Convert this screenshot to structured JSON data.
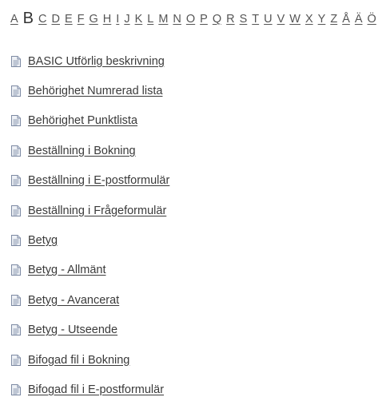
{
  "alphabet": {
    "active": "B",
    "letters": [
      "A",
      "B",
      "C",
      "D",
      "E",
      "F",
      "G",
      "H",
      "I",
      "J",
      "K",
      "L",
      "M",
      "N",
      "O",
      "P",
      "Q",
      "R",
      "S",
      "T",
      "U",
      "V",
      "W",
      "X",
      "Y",
      "Z",
      "Å",
      "Ä",
      "Ö"
    ]
  },
  "document_icon": "document-icon",
  "documents": [
    "BASIC Utförlig beskrivning",
    "Behörighet Numrerad lista",
    "Behörighet Punktlista",
    "Beställning i Bokning",
    "Beställning i E-postformulär",
    "Beställning i Frågeformulär",
    "Betyg",
    "Betyg - Allmänt",
    "Betyg - Avancerat",
    "Betyg - Utseende",
    "Bifogad fil i Bokning",
    "Bifogad fil i E-postformulär"
  ]
}
